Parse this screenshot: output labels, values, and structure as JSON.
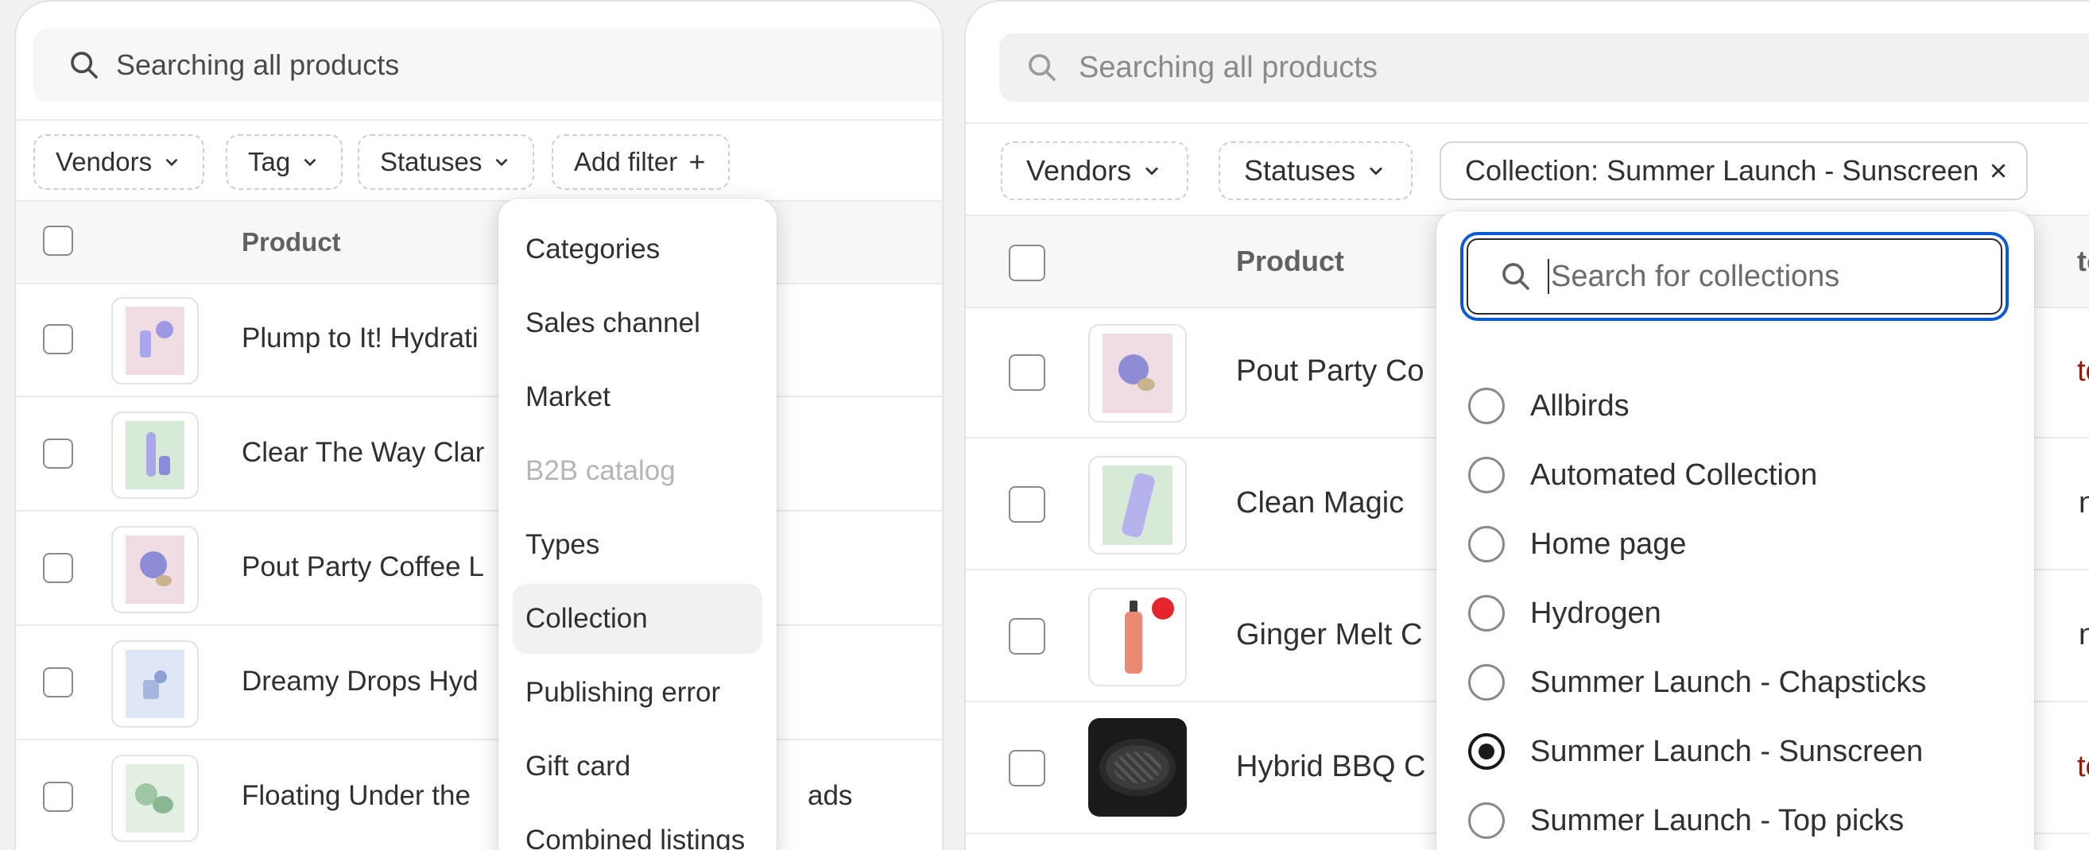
{
  "left": {
    "search_placeholder": "Searching all products",
    "filters": [
      "Vendors",
      "Tag",
      "Statuses"
    ],
    "add_filter_label": "Add filter",
    "table_header": "Product",
    "rows": [
      {
        "name": "Plump to It! Hydrati",
        "thumb_color": "#f0dde3"
      },
      {
        "name": "Clear The Way Clar",
        "thumb_color": "#d7ead8"
      },
      {
        "name": "Pout Party Coffee L",
        "thumb_color": "#f0dde3"
      },
      {
        "name": "Dreamy Drops Hyd",
        "thumb_color": "#dfe7f6"
      },
      {
        "name": "Floating Under the",
        "thumb_color": "#e4efe4",
        "trailing": "ads"
      }
    ],
    "menu_items": [
      {
        "label": "Categories"
      },
      {
        "label": "Sales channel"
      },
      {
        "label": "Market"
      },
      {
        "label": "B2B catalog",
        "disabled": true
      },
      {
        "label": "Types"
      },
      {
        "label": "Collection",
        "selected": true
      },
      {
        "label": "Publishing error"
      },
      {
        "label": "Gift card"
      },
      {
        "label": "Combined listings"
      }
    ]
  },
  "right": {
    "search_placeholder": "Searching all products",
    "filters": [
      "Vendors",
      "Statuses"
    ],
    "active_filter_label": "Collection: Summer Launch - Sunscreen",
    "table_header": "Product",
    "header_trailing": "to",
    "rows": [
      {
        "name": "Pout Party Co",
        "thumb_color": "#f0dde3",
        "trailing": "to"
      },
      {
        "name": "Clean Magic",
        "thumb_color": "#d7ead8",
        "trailing": "n"
      },
      {
        "name": "Ginger Melt C",
        "thumb_color": "#ffffff",
        "trailing": "n s"
      },
      {
        "name": "Hybrid BBQ C",
        "thumb_color": "#1a1a1a",
        "trailing": "to"
      }
    ],
    "collection_search_placeholder": "Search for collections",
    "collections": [
      {
        "label": "Allbirds",
        "selected": false
      },
      {
        "label": "Automated Collection",
        "selected": false
      },
      {
        "label": "Home page",
        "selected": false
      },
      {
        "label": "Hydrogen",
        "selected": false
      },
      {
        "label": "Summer Launch - Chapsticks",
        "selected": false
      },
      {
        "label": "Summer Launch - Sunscreen",
        "selected": true
      },
      {
        "label": "Summer Launch - Top picks",
        "selected": false
      }
    ]
  }
}
